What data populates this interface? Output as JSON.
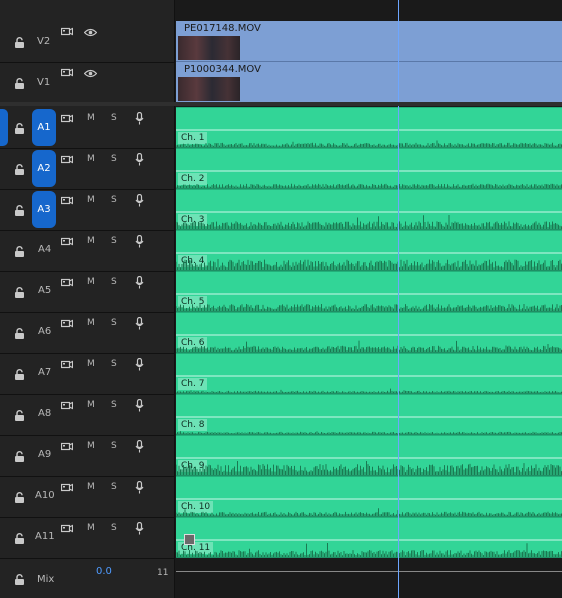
{
  "tracks": {
    "video": [
      {
        "name": "V2",
        "clip": "PE017148.MOV"
      },
      {
        "name": "V1",
        "clip": "P1000344.MOV"
      }
    ],
    "audio": [
      {
        "name": "A1",
        "targeted": true,
        "clip": "Ch. 1",
        "mute": "M",
        "solo": "S"
      },
      {
        "name": "A2",
        "targeted": true,
        "clip": "Ch. 2",
        "mute": "M",
        "solo": "S"
      },
      {
        "name": "A3",
        "targeted": true,
        "clip": "Ch. 3",
        "mute": "M",
        "solo": "S"
      },
      {
        "name": "A4",
        "targeted": false,
        "clip": "Ch. 4",
        "mute": "M",
        "solo": "S"
      },
      {
        "name": "A5",
        "targeted": false,
        "clip": "Ch. 5",
        "mute": "M",
        "solo": "S"
      },
      {
        "name": "A6",
        "targeted": false,
        "clip": "Ch. 6",
        "mute": "M",
        "solo": "S"
      },
      {
        "name": "A7",
        "targeted": false,
        "clip": "Ch. 7",
        "mute": "M",
        "solo": "S"
      },
      {
        "name": "A8",
        "targeted": false,
        "clip": "Ch. 8",
        "mute": "M",
        "solo": "S"
      },
      {
        "name": "A9",
        "targeted": false,
        "clip": "Ch. 9",
        "mute": "M",
        "solo": "S"
      },
      {
        "name": "A10",
        "targeted": false,
        "clip": "Ch. 10",
        "mute": "M",
        "solo": "S"
      },
      {
        "name": "A11",
        "targeted": false,
        "clip": "Ch. 11",
        "mute": "M",
        "solo": "S"
      }
    ],
    "mix": {
      "name": "Mix",
      "value": "0.0",
      "end_label": "11"
    }
  },
  "colors": {
    "video_clip": "#7d9fd4",
    "audio_clip": "#32d597",
    "target_blue": "#1667cc",
    "playhead": "#6da6ff"
  },
  "icons": [
    "lock-icon",
    "sync-lock-icon",
    "eye-icon",
    "mic-icon"
  ]
}
